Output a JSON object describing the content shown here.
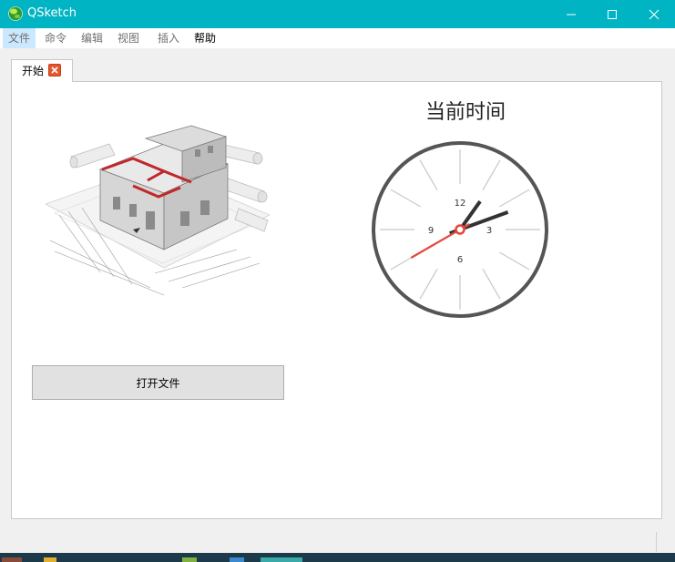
{
  "window": {
    "title": "QSketch"
  },
  "menu": [
    {
      "label": "文件",
      "state": "active"
    },
    {
      "label": "命令",
      "state": "disabled"
    },
    {
      "label": "编辑",
      "state": "disabled"
    },
    {
      "label": "视图",
      "state": "disabled"
    },
    {
      "label": "插入",
      "state": "disabled"
    },
    {
      "label": "帮助",
      "state": "enabled"
    }
  ],
  "tabs": [
    {
      "label": "开始",
      "closable": true
    }
  ],
  "start_page": {
    "open_button_label": "打开文件",
    "clock": {
      "title": "当前时间",
      "numerals": [
        "12",
        "3",
        "6",
        "9"
      ],
      "time_shown": "1:11:40"
    },
    "illustration": "architectural-house-model"
  },
  "colors": {
    "titlebar": "#00b4c3",
    "tab_close": "#e8542c",
    "clock_second_hand": "#e5473c",
    "clock_rim": "#555555"
  },
  "icons": {
    "app": "qsketch-globe-icon",
    "minimize": "minimize-icon",
    "maximize": "maximize-icon",
    "close": "close-icon",
    "tab_close": "close-icon"
  }
}
